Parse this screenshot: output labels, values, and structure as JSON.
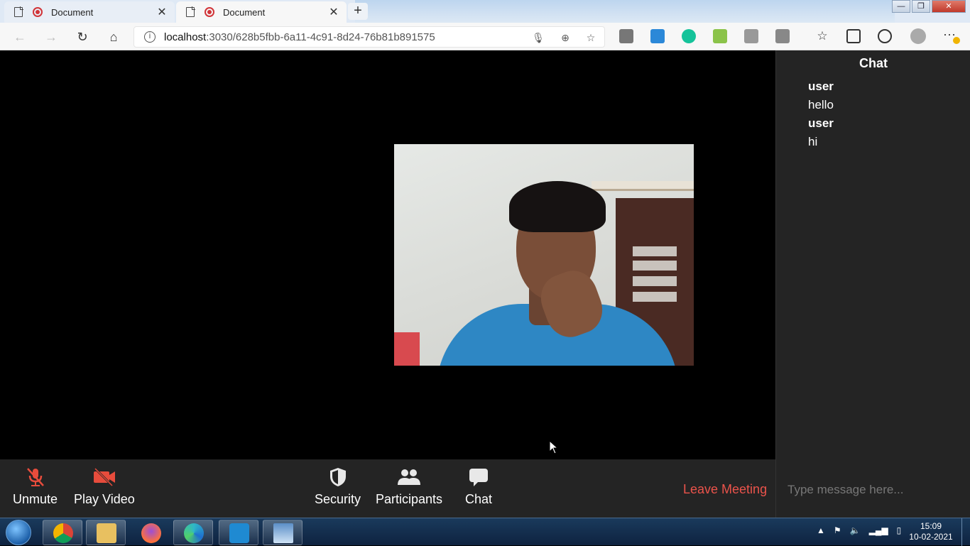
{
  "browser": {
    "tabs": [
      {
        "title": "Document",
        "close": "✕"
      },
      {
        "title": "Document",
        "close": "✕"
      }
    ],
    "new_tab": "+",
    "url_host": "localhost",
    "url_path": ":3030/628b5fbb-6a11-4c91-8d24-76b81b891575",
    "more": "···"
  },
  "meeting": {
    "controls": {
      "unmute": "Unmute",
      "play_video": "Play Video",
      "security": "Security",
      "participants": "Participants",
      "chat": "Chat",
      "leave": "Leave Meeting"
    },
    "colors": {
      "muted": "#e74c3c",
      "leave": "#eb534b",
      "panel": "#242424"
    }
  },
  "chat": {
    "title": "Chat",
    "messages": [
      {
        "user": "user",
        "text": "hello"
      },
      {
        "user": "user",
        "text": "hi"
      }
    ],
    "input_placeholder": "Type message here..."
  },
  "taskbar": {
    "time": "15:09",
    "date": "10-02-2021",
    "apps": [
      "chrome-icon",
      "file-explorer-icon",
      "firefox-icon",
      "edge-icon",
      "vscode-icon",
      "image-viewer-icon"
    ]
  }
}
